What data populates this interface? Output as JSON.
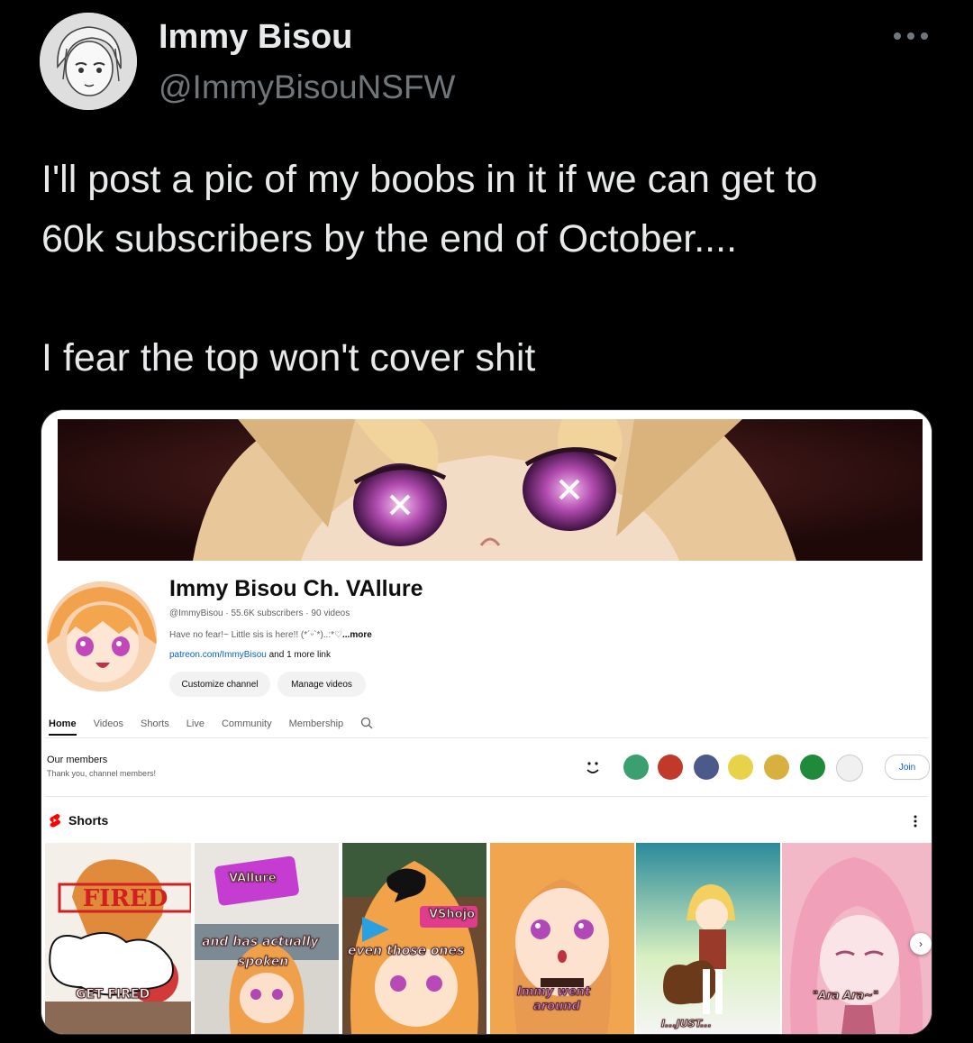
{
  "tweet": {
    "author_name": "Immy Bisou",
    "author_handle": "@ImmyBisouNSFW",
    "text_line1": "I'll post a pic of my boobs in it if we can get to",
    "text_line2": "60k subscribers by the end of October....",
    "text_line3": "I fear the top won't cover shit",
    "avatar_icon": "sketch-girl-avatar",
    "more_icon": "more-dots-icon"
  },
  "screenshot": {
    "channel_name": "Immy Bisou Ch. VAllure",
    "channel_meta": "@ImmyBisou · 55.6K subscribers · 90 videos",
    "channel_desc": "Have no fear!~ Little sis is here!! (*´ᵕ`*)..:*♡",
    "channel_desc_more": "...more",
    "channel_link": "patreon.com/ImmyBisou",
    "channel_link_more": " and 1 more link",
    "customize_label": "Customize channel",
    "manage_label": "Manage videos",
    "tabs": [
      "Home",
      "Videos",
      "Shorts",
      "Live",
      "Community",
      "Membership"
    ],
    "members_title": "Our members",
    "members_sub": "Thank you, channel members!",
    "join_label": "Join",
    "shorts_label": "Shorts",
    "shorts": [
      {
        "caption1": "GET FIRED",
        "sign": "FIRED"
      },
      {
        "caption1": "and has actually",
        "caption2": "spoken",
        "logo": "VAllure"
      },
      {
        "caption1": "even those ones",
        "logo": "VShojo"
      },
      {
        "caption1": "Immy went",
        "caption2": "around"
      },
      {
        "caption1": "I...JUST..."
      },
      {
        "caption1": "\"Ara Ara~\""
      }
    ],
    "colors": {
      "link": "#065fd4",
      "bg": "#ffffff",
      "text": "#0f0f0f",
      "secondary": "#606060",
      "shorts_red": "#ff0000"
    }
  }
}
